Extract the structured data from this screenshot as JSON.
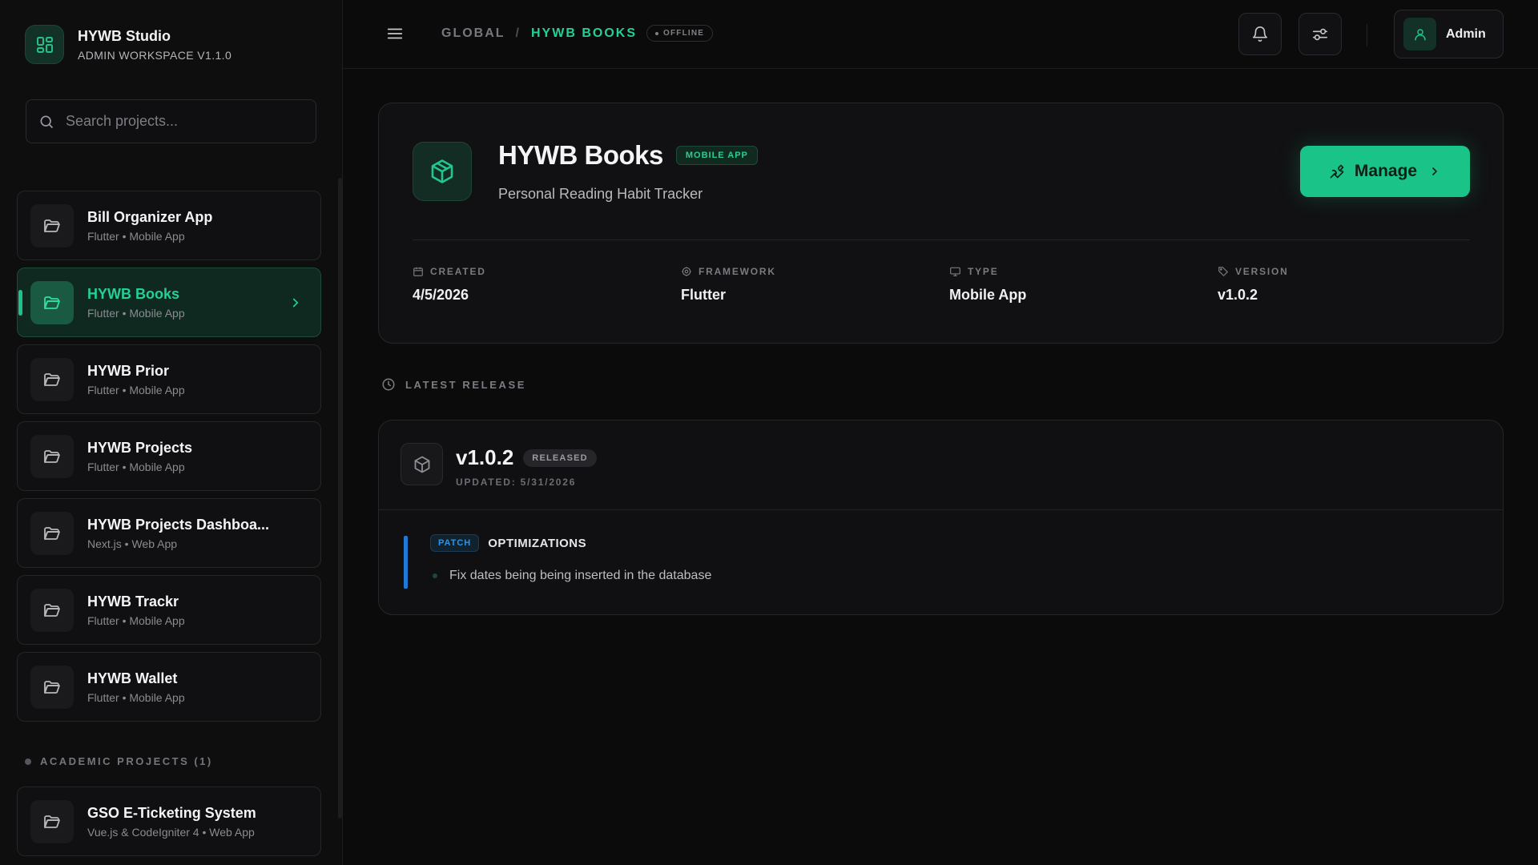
{
  "brand": {
    "title": "HYWB Studio",
    "subtitle": "ADMIN WORKSPACE V1.1.0"
  },
  "search": {
    "placeholder": "Search projects...",
    "value": ""
  },
  "projects": [
    {
      "name": "Bill Organizer App",
      "meta": "Flutter • Mobile App",
      "active": false
    },
    {
      "name": "HYWB Books",
      "meta": "Flutter • Mobile App",
      "active": true
    },
    {
      "name": "HYWB Prior",
      "meta": "Flutter • Mobile App",
      "active": false
    },
    {
      "name": "HYWB Projects",
      "meta": "Flutter • Mobile App",
      "active": false
    },
    {
      "name": "HYWB Projects Dashboa...",
      "meta": "Next.js • Web App",
      "active": false
    },
    {
      "name": "HYWB Trackr",
      "meta": "Flutter • Mobile App",
      "active": false
    },
    {
      "name": "HYWB Wallet",
      "meta": "Flutter • Mobile App",
      "active": false
    }
  ],
  "academic": {
    "label": "ACADEMIC PROJECTS (1)",
    "projects": [
      {
        "name": "GSO E-Ticketing System",
        "meta": "Vue.js & CodeIgniter 4 • Web App"
      }
    ]
  },
  "header": {
    "breadcrumb": {
      "root": "GLOBAL",
      "separator": "/",
      "current": "HYWB BOOKS"
    },
    "status": "OFFLINE",
    "user_label": "Admin"
  },
  "project": {
    "title": "HYWB Books",
    "badge": "MOBILE APP",
    "description": "Personal Reading Habit Tracker",
    "manage_label": "Manage",
    "stats": {
      "created": {
        "label": "CREATED",
        "value": "4/5/2026"
      },
      "framework": {
        "label": "FRAMEWORK",
        "value": "Flutter"
      },
      "type": {
        "label": "TYPE",
        "value": "Mobile App"
      },
      "version": {
        "label": "VERSION",
        "value": "v1.0.2"
      }
    }
  },
  "release": {
    "section_label": "LATEST RELEASE",
    "version": "v1.0.2",
    "status": "RELEASED",
    "updated": "UPDATED: 5/31/2026",
    "group_tag": "PATCH",
    "group_name": "OPTIMIZATIONS",
    "items": [
      "Fix dates being being inserted in the database"
    ]
  },
  "colors": {
    "accent": "#1ac488",
    "background": "#0b0b0c",
    "patch_blue": "#2e94e8"
  }
}
